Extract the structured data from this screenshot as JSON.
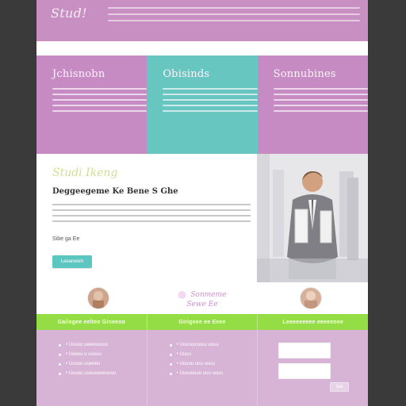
{
  "brand": {
    "logo_text": "Stud!"
  },
  "header": {
    "line_count": 3
  },
  "columns": [
    {
      "title": "Jchisnobn",
      "color": "#c68bc2",
      "lines": [
        "———————————",
        "———————————",
        "———————————",
        "——————————",
        "——————————"
      ]
    },
    {
      "title": "Obisinds",
      "color": "#67c6c0",
      "lines": [
        "———————————",
        "———————————",
        "———————————",
        "——————————",
        "——————————"
      ]
    },
    {
      "title": "Sonnubines",
      "color": "#c68bc2",
      "lines": [
        "———————————",
        "———————————",
        "———————————",
        "——————————",
        "——————————"
      ]
    }
  ],
  "feature": {
    "script_heading": "Studi Ikeng ",
    "heading": "Deggeegeme Ke Bene S Ghe",
    "lines": [
      "———————————————————————————",
      "———————————————————————————",
      "———————————————————————————",
      "———————————————————————————"
    ],
    "label": "Sibe ga Ee",
    "button_label": "Leeaneem"
  },
  "profiles": {
    "script_text_1": "Sonmeme",
    "script_text_2": "Sewe Ee",
    "avatar_left": "avatar",
    "avatar_right": "avatar"
  },
  "green_bar": {
    "items": [
      "Gailegee eeltee Gineeoo",
      "Girigeee ee Eeee",
      "Leeeeeeeee eeeeeoee"
    ]
  },
  "bottom": {
    "list_1": [
      "•  Uuuuu ueeeuuuuu",
      "•  Ueeuu u uuuuu",
      "•  Uuuuu uueeeu",
      "•  Uuuuu uuuueeeeuuuu"
    ],
    "list_2": [
      "•  Uuuuuuuuuu uuuu",
      "•  Uuuu",
      "•  Uuuuu uuu uuuu",
      "•  Uuuuuuuu uuu uuuu"
    ],
    "submit_label": "Sub"
  },
  "colors": {
    "header": "#c78fc2",
    "teal": "#67c6c0",
    "pink": "#c68bc2",
    "green": "#95dd45",
    "background": "#d7b3d6"
  }
}
